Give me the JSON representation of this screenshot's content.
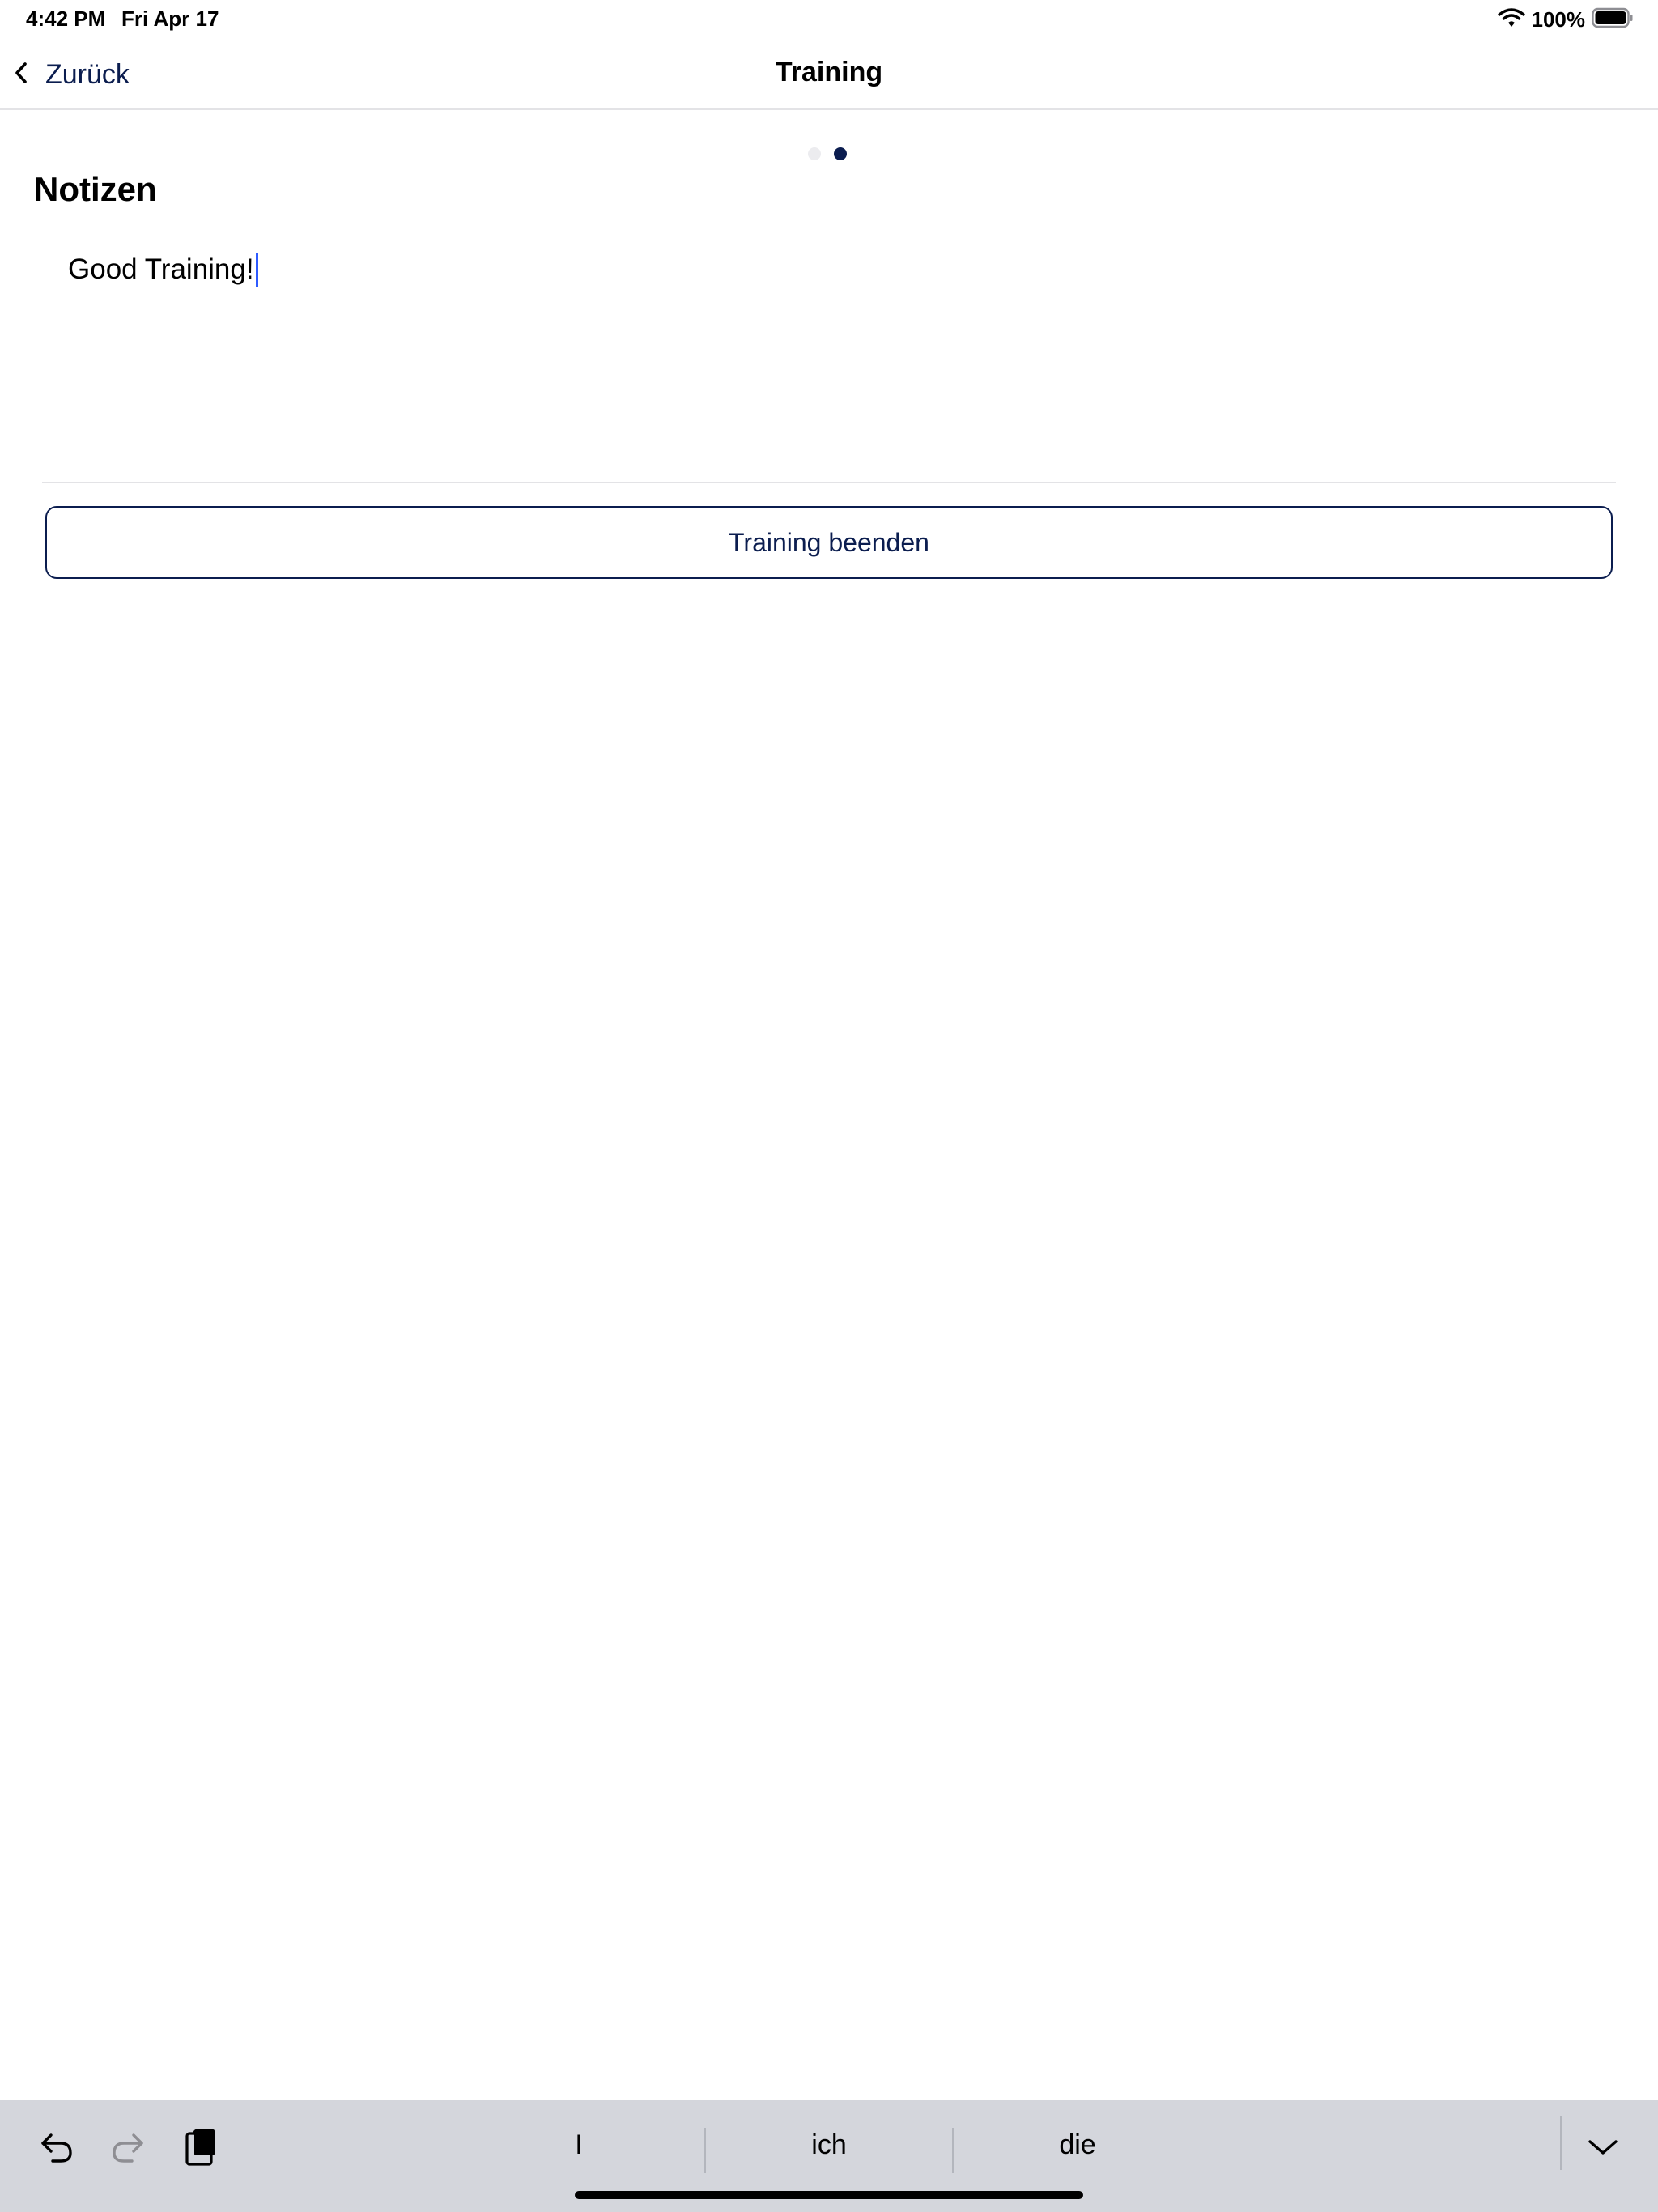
{
  "status_bar": {
    "time": "4:42 PM",
    "date": "Fri Apr 17",
    "battery": "100%"
  },
  "nav": {
    "back_label": "Zurück",
    "title": "Training"
  },
  "pager": {
    "count": 2,
    "active_index": 1
  },
  "notes": {
    "title": "Notizen",
    "value": "Good Training!"
  },
  "finish_button": {
    "label": "Training beenden"
  },
  "keyboard_bar": {
    "suggestions": [
      "I",
      "ich",
      "die"
    ]
  },
  "colors": {
    "accent": "#0b1d4f",
    "caret": "#2e5bff",
    "keyboard_bg": "#d4d6dc"
  }
}
